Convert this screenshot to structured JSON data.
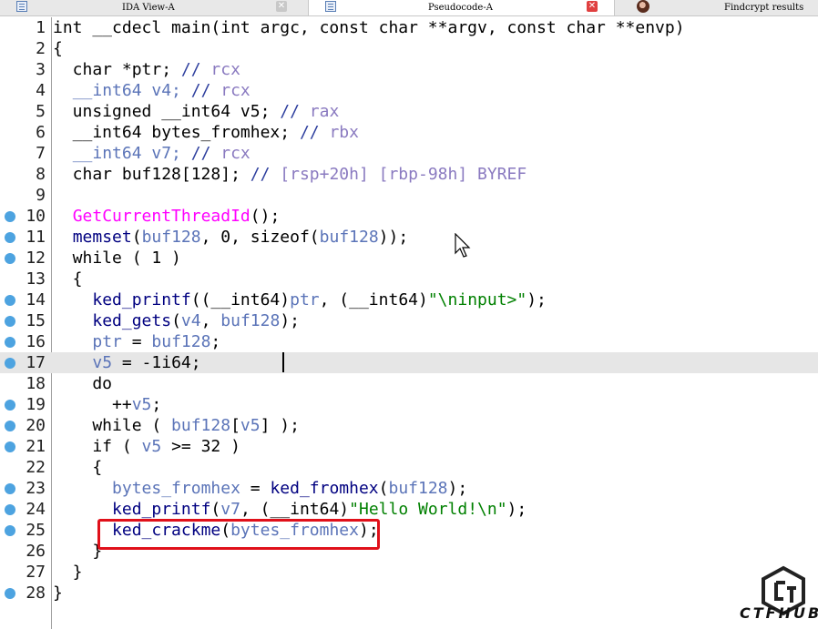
{
  "tabs": [
    {
      "label": "IDA View-A",
      "active": false
    },
    {
      "label": "Pseudocode-A",
      "active": true
    },
    {
      "label": "Findcrypt results",
      "active": false
    }
  ],
  "code_lines": [
    {
      "n": "1",
      "bp": false,
      "tokens": [
        [
          "kw",
          "int __cdecl main(int argc, const char **argv, const char **envp)"
        ]
      ]
    },
    {
      "n": "2",
      "bp": false,
      "tokens": [
        [
          "kw",
          "{"
        ]
      ]
    },
    {
      "n": "3",
      "bp": false,
      "tokens": [
        [
          "kw",
          "  char *ptr; "
        ],
        [
          "cmt",
          "// "
        ],
        [
          "cv",
          "rcx"
        ]
      ]
    },
    {
      "n": "4",
      "bp": false,
      "tokens": [
        [
          "kw",
          "  "
        ],
        [
          "var",
          "__int64 v4; "
        ],
        [
          "cmt",
          "// "
        ],
        [
          "cv",
          "rcx"
        ]
      ]
    },
    {
      "n": "5",
      "bp": false,
      "tokens": [
        [
          "kw",
          "  unsigned __int64 v5; "
        ],
        [
          "cmt",
          "// "
        ],
        [
          "cv",
          "rax"
        ]
      ]
    },
    {
      "n": "6",
      "bp": false,
      "tokens": [
        [
          "kw",
          "  __int64 bytes_fromhex; "
        ],
        [
          "cmt",
          "// "
        ],
        [
          "cv",
          "rbx"
        ]
      ]
    },
    {
      "n": "7",
      "bp": false,
      "tokens": [
        [
          "kw",
          "  "
        ],
        [
          "var",
          "__int64 v7; "
        ],
        [
          "cmt",
          "// "
        ],
        [
          "cv",
          "rcx"
        ]
      ]
    },
    {
      "n": "8",
      "bp": false,
      "tokens": [
        [
          "kw",
          "  char buf128[128]; "
        ],
        [
          "cmt",
          "// "
        ],
        [
          "cv",
          "[rsp+20h] [rbp-98h] BYREF"
        ]
      ]
    },
    {
      "n": "9",
      "bp": false,
      "tokens": [
        [
          "kw",
          ""
        ]
      ]
    },
    {
      "n": "10",
      "bp": true,
      "tokens": [
        [
          "kw",
          "  "
        ],
        [
          "imp",
          "GetCurrentThreadId"
        ],
        [
          "kw",
          "();"
        ]
      ]
    },
    {
      "n": "11",
      "bp": true,
      "tokens": [
        [
          "kw",
          "  "
        ],
        [
          "fn",
          "memset"
        ],
        [
          "kw",
          "("
        ],
        [
          "var",
          "buf128"
        ],
        [
          "kw",
          ", 0, sizeof("
        ],
        [
          "var",
          "buf128"
        ],
        [
          "kw",
          "));"
        ]
      ]
    },
    {
      "n": "12",
      "bp": true,
      "tokens": [
        [
          "kw",
          "  while ( 1 )"
        ]
      ]
    },
    {
      "n": "13",
      "bp": false,
      "tokens": [
        [
          "kw",
          "  {"
        ]
      ]
    },
    {
      "n": "14",
      "bp": true,
      "tokens": [
        [
          "kw",
          "    "
        ],
        [
          "fn",
          "ked_printf"
        ],
        [
          "kw",
          "((__int64)"
        ],
        [
          "var",
          "ptr"
        ],
        [
          "kw",
          ", (__int64)"
        ],
        [
          "str",
          "\"\\ninput>\""
        ],
        [
          "kw",
          ");"
        ]
      ]
    },
    {
      "n": "15",
      "bp": true,
      "tokens": [
        [
          "kw",
          "    "
        ],
        [
          "fn",
          "ked_gets"
        ],
        [
          "kw",
          "("
        ],
        [
          "var",
          "v4"
        ],
        [
          "kw",
          ", "
        ],
        [
          "var",
          "buf128"
        ],
        [
          "kw",
          ");"
        ]
      ]
    },
    {
      "n": "16",
      "bp": true,
      "tokens": [
        [
          "kw",
          "    "
        ],
        [
          "var",
          "ptr"
        ],
        [
          "kw",
          " = "
        ],
        [
          "var",
          "buf128"
        ],
        [
          "kw",
          ";"
        ]
      ]
    },
    {
      "n": "17",
      "bp": true,
      "hl": true,
      "tokens": [
        [
          "kw",
          "    "
        ],
        [
          "var",
          "v5"
        ],
        [
          "kw",
          " = -1i64;"
        ]
      ]
    },
    {
      "n": "18",
      "bp": false,
      "tokens": [
        [
          "kw",
          "    do"
        ]
      ]
    },
    {
      "n": "19",
      "bp": true,
      "tokens": [
        [
          "kw",
          "      ++"
        ],
        [
          "var",
          "v5"
        ],
        [
          "kw",
          ";"
        ]
      ]
    },
    {
      "n": "20",
      "bp": true,
      "tokens": [
        [
          "kw",
          "    while ( "
        ],
        [
          "var",
          "buf128"
        ],
        [
          "kw",
          "["
        ],
        [
          "var",
          "v5"
        ],
        [
          "kw",
          "] );"
        ]
      ]
    },
    {
      "n": "21",
      "bp": true,
      "tokens": [
        [
          "kw",
          "    if ( "
        ],
        [
          "var",
          "v5"
        ],
        [
          "kw",
          " >= 32 )"
        ]
      ]
    },
    {
      "n": "22",
      "bp": false,
      "tokens": [
        [
          "kw",
          "    {"
        ]
      ]
    },
    {
      "n": "23",
      "bp": true,
      "tokens": [
        [
          "kw",
          "      "
        ],
        [
          "var",
          "bytes_fromhex"
        ],
        [
          "kw",
          " = "
        ],
        [
          "fn",
          "ked_fromhex"
        ],
        [
          "kw",
          "("
        ],
        [
          "var",
          "buf128"
        ],
        [
          "kw",
          ");"
        ]
      ]
    },
    {
      "n": "24",
      "bp": true,
      "tokens": [
        [
          "kw",
          "      "
        ],
        [
          "fn",
          "ked_printf"
        ],
        [
          "kw",
          "("
        ],
        [
          "var",
          "v7"
        ],
        [
          "kw",
          ", (__int64)"
        ],
        [
          "str",
          "\"Hello World!\\n\""
        ],
        [
          "kw",
          ");"
        ]
      ]
    },
    {
      "n": "25",
      "bp": true,
      "tokens": [
        [
          "kw",
          "      "
        ],
        [
          "fn",
          "ked_crackme"
        ],
        [
          "kw",
          "("
        ],
        [
          "var",
          "bytes_fromhex"
        ],
        [
          "kw",
          ");"
        ]
      ]
    },
    {
      "n": "26",
      "bp": false,
      "tokens": [
        [
          "kw",
          "    }"
        ]
      ]
    },
    {
      "n": "27",
      "bp": false,
      "tokens": [
        [
          "kw",
          "  }"
        ]
      ]
    },
    {
      "n": "28",
      "bp": true,
      "tokens": [
        [
          "kw",
          "}"
        ]
      ]
    }
  ],
  "logo": {
    "text": "CTFHUB"
  },
  "colors": {
    "breakpoint": "#4da3e0",
    "highlight_box": "#e0101a",
    "string": "#008000",
    "import": "#ff00ff"
  }
}
